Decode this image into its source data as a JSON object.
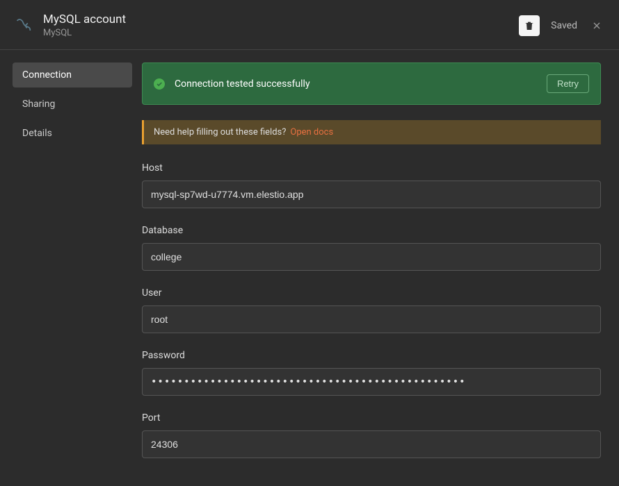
{
  "header": {
    "title": "MySQL account",
    "subtitle": "MySQL",
    "saved_label": "Saved"
  },
  "sidebar": {
    "items": [
      {
        "label": "Connection",
        "active": true
      },
      {
        "label": "Sharing",
        "active": false
      },
      {
        "label": "Details",
        "active": false
      }
    ]
  },
  "success": {
    "message": "Connection tested successfully",
    "retry_label": "Retry"
  },
  "help": {
    "text": "Need help filling out these fields?",
    "link_label": "Open docs"
  },
  "fields": {
    "host": {
      "label": "Host",
      "value": "mysql-sp7wd-u7774.vm.elestio.app"
    },
    "database": {
      "label": "Database",
      "value": "college"
    },
    "user": {
      "label": "User",
      "value": "root"
    },
    "password": {
      "label": "Password",
      "value": "••••••••••••••••••••••••••••••••••••••••••••••••"
    },
    "port": {
      "label": "Port",
      "value": "24306"
    }
  }
}
